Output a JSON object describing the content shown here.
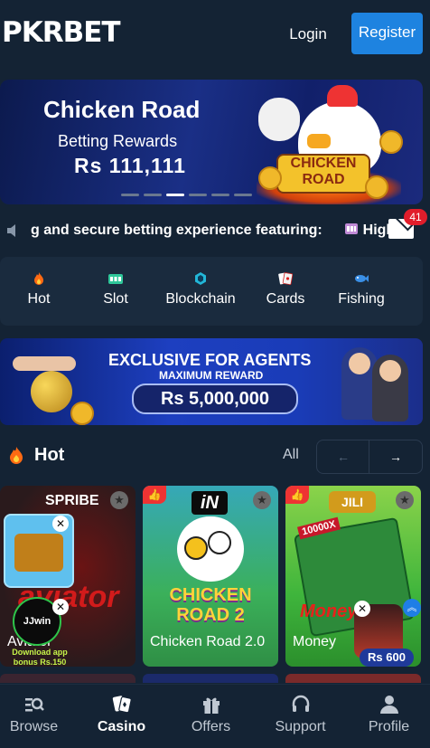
{
  "header": {
    "logo": "PKRBET",
    "login_label": "Login",
    "register_label": "Register"
  },
  "banner": {
    "title": "Chicken Road",
    "subtitle": "Betting Rewards",
    "amount": "Rs 111,111",
    "game_logo": "CHICKEN ROAD",
    "active_slide": 3,
    "slide_count": 6
  },
  "marquee": {
    "text": "g and secure betting experience featuring:",
    "tail": "High"
  },
  "notifications": {
    "count": "41"
  },
  "categories": [
    {
      "label": "Hot",
      "icon": "flame-icon"
    },
    {
      "label": "Slot",
      "icon": "slot-machine-icon"
    },
    {
      "label": "Blockchain",
      "icon": "blockchain-icon"
    },
    {
      "label": "Cards",
      "icon": "cards-icon"
    },
    {
      "label": "Fishing",
      "icon": "fish-icon"
    }
  ],
  "agents_banner": {
    "title": "EXCLUSIVE FOR AGENTS",
    "subtitle": "MAXIMUM REWARD",
    "amount": "Rs 5,000,000"
  },
  "hot_section": {
    "title": "Hot",
    "all_label": "All",
    "prev_label": "←",
    "next_label": "→"
  },
  "games": [
    {
      "name": "Aviator",
      "provider": "SPRIBE",
      "art_text": "aviator"
    },
    {
      "name": "Chicken Road 2.0",
      "provider": "iN",
      "art_text": "CHICKEN ROAD 2"
    },
    {
      "name": "Money",
      "provider": "JILI",
      "art_text": "Money"
    }
  ],
  "overlays": {
    "jjwin_label": "JJwin",
    "download_text": "Download app bonus Rs.150",
    "reward_badge": "Rs 600",
    "card3_banner": "10000X"
  },
  "bottom_nav": [
    {
      "label": "Browse",
      "icon": "browse-icon",
      "active": false
    },
    {
      "label": "Casino",
      "icon": "casino-icon",
      "active": true
    },
    {
      "label": "Offers",
      "icon": "gift-icon",
      "active": false
    },
    {
      "label": "Support",
      "icon": "headset-icon",
      "active": false
    },
    {
      "label": "Profile",
      "icon": "user-icon",
      "active": false
    }
  ],
  "colors": {
    "background": "#142334",
    "accent": "#1e83e0",
    "badge": "#e11d2b"
  }
}
